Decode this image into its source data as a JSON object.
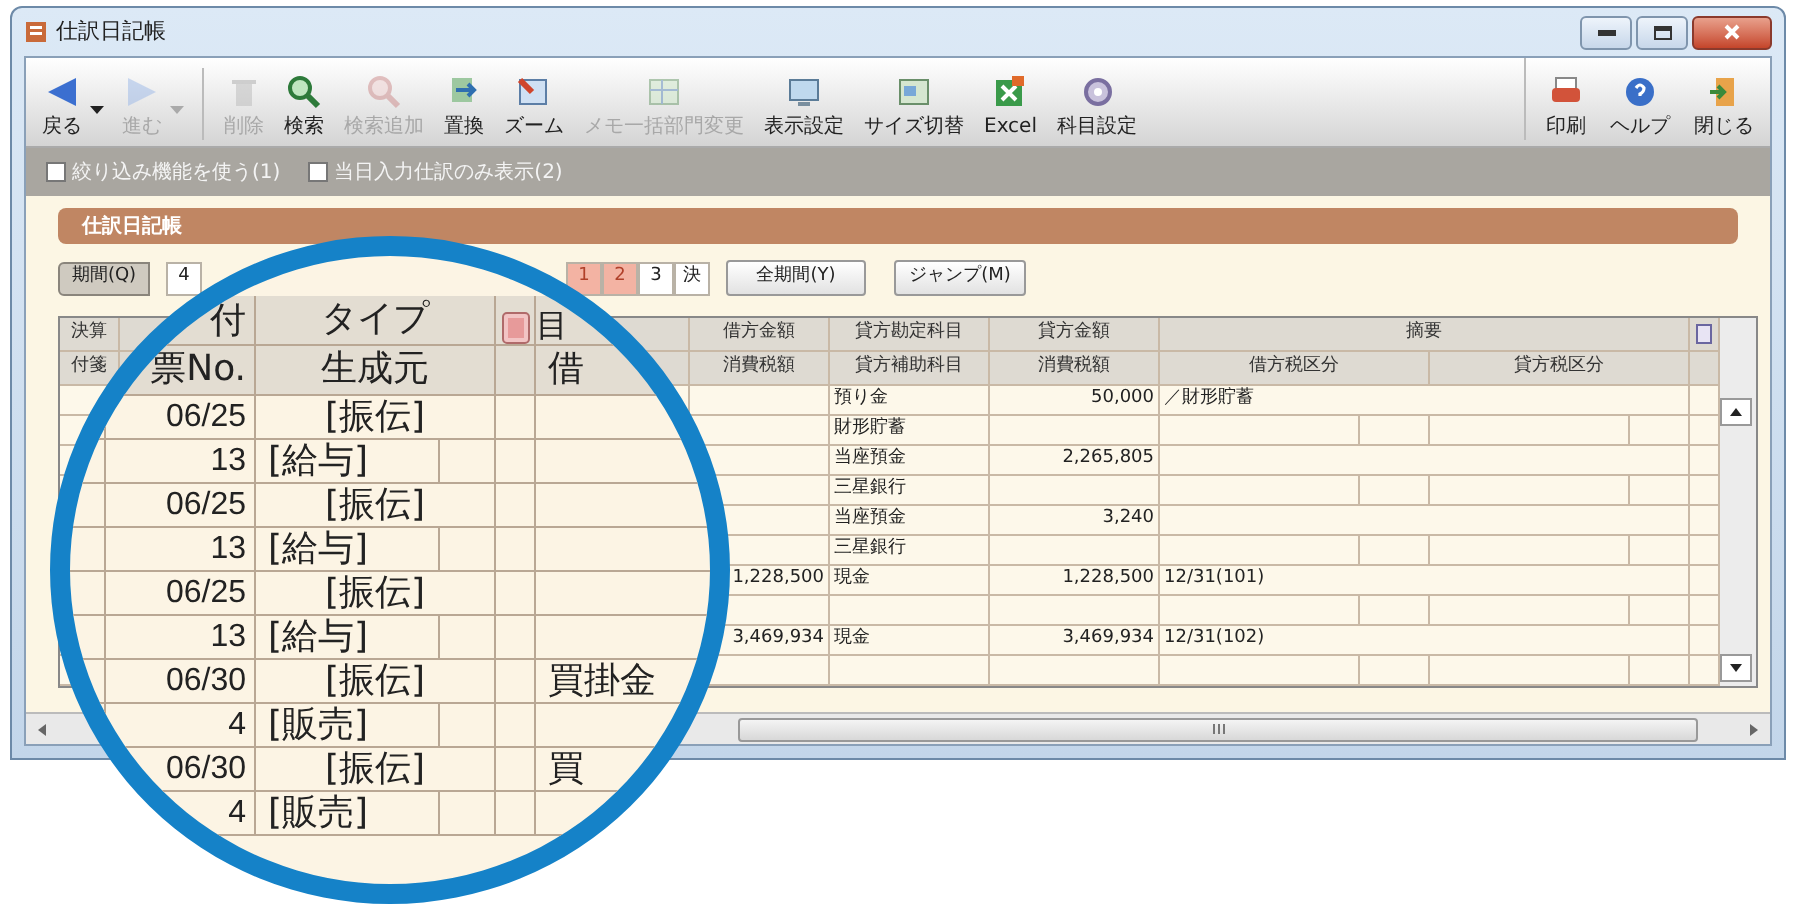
{
  "window": {
    "title": "仕訳日記帳"
  },
  "toolbar": {
    "left": [
      {
        "label": "戻る",
        "disabled": false,
        "menu": true
      },
      {
        "label": "進む",
        "disabled": true,
        "menu": true
      },
      {
        "label": "削除",
        "disabled": true,
        "menu": false
      },
      {
        "label": "検索",
        "disabled": false,
        "menu": false
      },
      {
        "label": "検索追加",
        "disabled": true,
        "menu": false
      },
      {
        "label": "置換",
        "disabled": false,
        "menu": false
      },
      {
        "label": "ズーム",
        "disabled": false,
        "menu": false
      },
      {
        "label": "メモ一括部門変更",
        "disabled": true,
        "menu": false
      },
      {
        "label": "表示設定",
        "disabled": false,
        "menu": false
      },
      {
        "label": "サイズ切替",
        "disabled": false,
        "menu": false
      },
      {
        "label": "Excel",
        "disabled": false,
        "menu": false
      },
      {
        "label": "科目設定",
        "disabled": false,
        "menu": false
      }
    ],
    "right": [
      {
        "label": "印刷",
        "disabled": false
      },
      {
        "label": "ヘルプ",
        "disabled": false
      },
      {
        "label": "閉じる",
        "disabled": false
      }
    ]
  },
  "filters": [
    {
      "label": "絞り込み機能を使う(1)",
      "checked": false
    },
    {
      "label": "当日入力仕訳のみ表示(2)",
      "checked": false
    }
  ],
  "section_title": "仕訳日記帳",
  "period": {
    "button": "期間(Q)",
    "months": [
      {
        "label": "4",
        "selected": false
      },
      {
        "label": "1",
        "selected": true
      },
      {
        "label": "2",
        "selected": true
      },
      {
        "label": "3",
        "selected": false
      },
      {
        "label": "決",
        "selected": false
      }
    ],
    "all_button": "全期間(Y)",
    "jump_button": "ジャンプ(M)"
  },
  "table": {
    "first_column": {
      "top": "決算",
      "bottom": "付箋"
    },
    "columns": [
      {
        "top": "借方金額",
        "bottom": "消費税額"
      },
      {
        "top": "貸方勘定科目",
        "bottom": "貸方補助科目"
      },
      {
        "top": "貸方金額",
        "bottom": "消費税額"
      }
    ],
    "memo_header": "摘要",
    "memo_subheaders": [
      "借方税区分",
      "貸方税区分"
    ],
    "entries": [
      {
        "credit_account": "預り金",
        "credit_amount": "50,000",
        "memo": "／財形貯蓄",
        "credit_sub_account": "財形貯蓄"
      },
      {
        "credit_account": "当座預金",
        "credit_amount": "2,265,805",
        "credit_sub_account": "三星銀行"
      },
      {
        "credit_account": "当座預金",
        "credit_amount": "3,240",
        "credit_sub_account": "三星銀行"
      },
      {
        "debit_amount": "1,228,500",
        "credit_account": "現金",
        "credit_amount": "1,228,500",
        "memo": "12/31(101)"
      },
      {
        "debit_amount": "3,469,934",
        "credit_account": "現金",
        "credit_amount": "3,469,934",
        "memo": "12/31(102)"
      }
    ]
  },
  "magnifier": {
    "headers_top": [
      "付",
      "タイプ",
      "目"
    ],
    "headers_bottom": [
      "票No.",
      "生成元",
      "借"
    ],
    "entries": [
      {
        "date": "06/25",
        "type": "[振伝]",
        "number": "13",
        "source": "[給与]"
      },
      {
        "date": "06/25",
        "type": "[振伝]",
        "number": "13",
        "source": "[給与]"
      },
      {
        "date": "06/25",
        "type": "[振伝]",
        "number": "13",
        "source": "[給与]"
      },
      {
        "date": "06/30",
        "type": "[振伝]",
        "account": "買掛金",
        "number": "4",
        "source": "[販売]"
      },
      {
        "date": "06/30",
        "type": "[振伝]",
        "account": "買",
        "number": "4",
        "source": "[販売]"
      }
    ]
  }
}
